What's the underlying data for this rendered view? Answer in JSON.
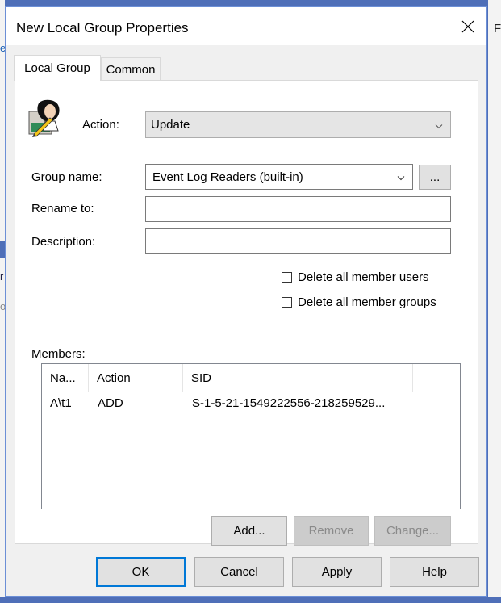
{
  "background": {
    "right_text": "F",
    "left_glyphs": [
      "e",
      "r",
      "o"
    ]
  },
  "dialog": {
    "title": "New Local Group Properties",
    "close_icon": "close-icon"
  },
  "tabs": [
    {
      "label": "Local Group",
      "active": true
    },
    {
      "label": "Common",
      "active": false
    }
  ],
  "action": {
    "label": "Action:",
    "value": "Update",
    "icon": "group-user-icon"
  },
  "group_name": {
    "label": "Group name:",
    "value": "Event Log Readers (built-in)",
    "browse_label": "..."
  },
  "rename_to": {
    "label": "Rename to:",
    "value": ""
  },
  "description": {
    "label": "Description:",
    "value": ""
  },
  "checkboxes": [
    {
      "label": "Delete all member users",
      "checked": false
    },
    {
      "label": "Delete all member groups",
      "checked": false
    }
  ],
  "members": {
    "label": "Members:",
    "columns": [
      "Na...",
      "Action",
      "SID"
    ],
    "rows": [
      {
        "name": "A\\t1",
        "action": "ADD",
        "sid": "S-1-5-21-1549222556-218259529..."
      }
    ]
  },
  "member_buttons": {
    "add": "Add...",
    "remove": "Remove",
    "change": "Change..."
  },
  "footer_buttons": {
    "ok": "OK",
    "cancel": "Cancel",
    "apply": "Apply",
    "help": "Help"
  },
  "colors": {
    "accent": "#0078d7",
    "desktop": "#4f6fb8"
  }
}
